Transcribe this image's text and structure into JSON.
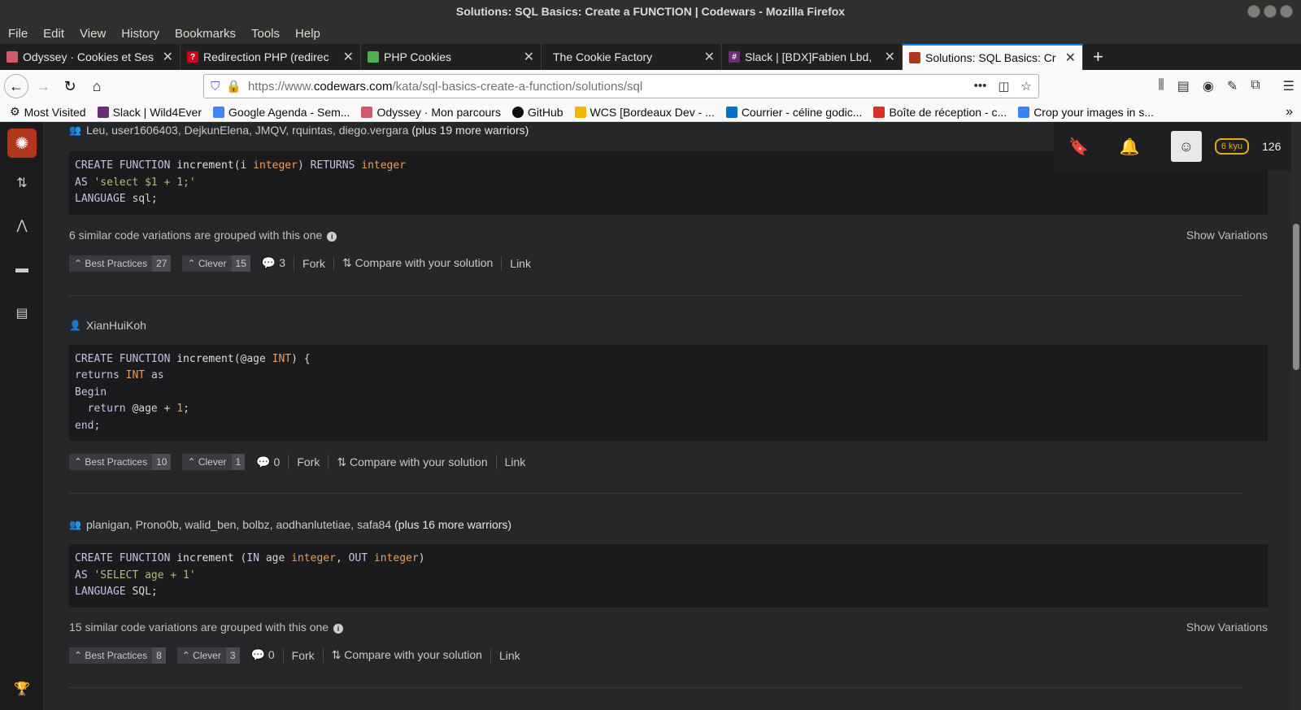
{
  "window": {
    "title": "Solutions: SQL Basics: Create a FUNCTION | Codewars - Mozilla Firefox"
  },
  "menu": [
    "File",
    "Edit",
    "View",
    "History",
    "Bookmarks",
    "Tools",
    "Help"
  ],
  "tabs": [
    {
      "title": "Odyssey · Cookies et Ses",
      "favicon_color": "#d05a6b"
    },
    {
      "title": "Redirection PHP (redirec",
      "favicon_color": "#d0021b"
    },
    {
      "title": "PHP Cookies",
      "favicon_color": "#4caf50"
    },
    {
      "title": "The Cookie Factory",
      "favicon_color": ""
    },
    {
      "title": "Slack | [BDX]Fabien Lbd,",
      "favicon_color": "#6b2d78"
    },
    {
      "title": "Solutions: SQL Basics: Cr",
      "favicon_color": "#b1361e",
      "active": true
    }
  ],
  "url": {
    "prefix": "https://www.",
    "host": "codewars.com",
    "path": "/kata/sql-basics-create-a-function/solutions/sql"
  },
  "bookmarks": [
    {
      "label": "Most Visited",
      "color": "#555"
    },
    {
      "label": "Slack | Wild4Ever",
      "color": "#6b2d78"
    },
    {
      "label": "Google Agenda - Sem...",
      "color": "#4285f4"
    },
    {
      "label": "Odyssey · Mon parcours",
      "color": "#d05a6b"
    },
    {
      "label": "GitHub",
      "color": "#111"
    },
    {
      "label": "WCS [Bordeaux Dev - ...",
      "color": "#f4b400"
    },
    {
      "label": "Courrier - céline godic...",
      "color": "#0072c6"
    },
    {
      "label": "Boîte de réception - c...",
      "color": "#d93025"
    },
    {
      "label": "Crop your images in s...",
      "color": "#3b82f6"
    }
  ],
  "userbar": {
    "rank": "6 kyu",
    "honor": "126"
  },
  "solutions": [
    {
      "authors": "Leu, user1606403, DejkunElena, JMQV, rquintas, diego.vergara",
      "plus": "(plus 19 more warriors)",
      "variations": "6 similar code variations are grouped with this one",
      "show_variations": "Show Variations",
      "best_practices": "Best Practices",
      "best_count": "27",
      "clever": "Clever",
      "clever_count": "15",
      "comments": "3",
      "fork": "Fork",
      "compare": "Compare with your solution",
      "link": "Link"
    },
    {
      "authors": "XianHuiKoh",
      "best_practices": "Best Practices",
      "best_count": "10",
      "clever": "Clever",
      "clever_count": "1",
      "comments": "0",
      "fork": "Fork",
      "compare": "Compare with your solution",
      "link": "Link"
    },
    {
      "authors": "planigan, Prono0b, walid_ben, bolbz, aodhanlutetiae, safa84",
      "plus": "(plus 16 more warriors)",
      "variations": "15 similar code variations are grouped with this one",
      "show_variations": "Show Variations",
      "best_practices": "Best Practices",
      "best_count": "8",
      "clever": "Clever",
      "clever_count": "3",
      "comments": "0",
      "fork": "Fork",
      "compare": "Compare with your solution",
      "link": "Link"
    }
  ],
  "code": {
    "s1": [
      "CREATE FUNCTION increment(i integer) RETURNS integer",
      "AS 'select $1 + 1;'",
      "LANGUAGE sql;"
    ],
    "s2": [
      "CREATE FUNCTION increment(@age INT) {",
      "returns INT as",
      "Begin",
      "  return @age + 1;",
      "end;"
    ],
    "s3": [
      "CREATE FUNCTION increment (IN age integer, OUT integer)",
      "AS 'SELECT age + 1'",
      "LANGUAGE SQL;"
    ]
  }
}
